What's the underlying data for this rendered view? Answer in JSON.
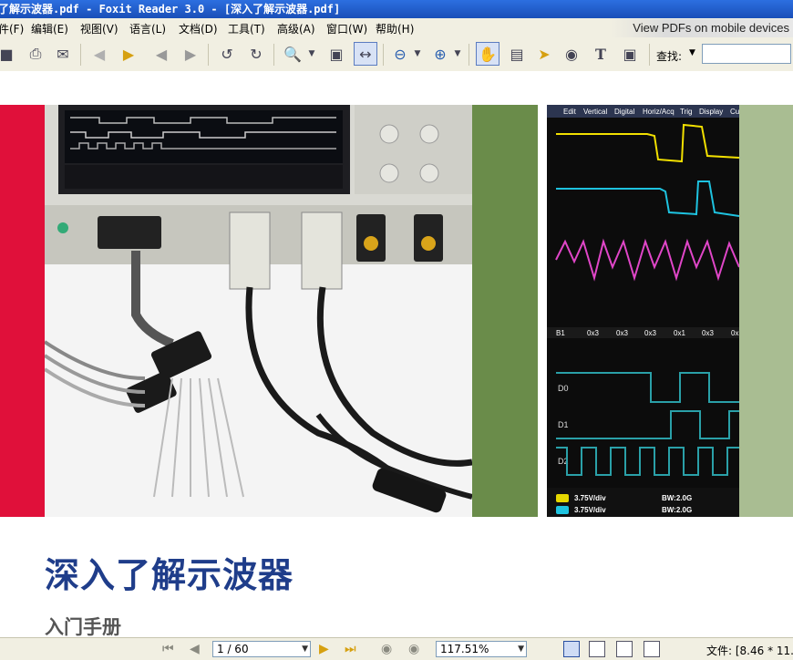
{
  "window": {
    "title": "了解示波器.pdf - Foxit Reader 3.0 - [深入了解示波器.pdf]"
  },
  "menu": [
    {
      "label": "件(F)"
    },
    {
      "label": "编辑(E)"
    },
    {
      "label": "视图(V)"
    },
    {
      "label": "语言(L)"
    },
    {
      "label": "文档(D)"
    },
    {
      "label": "工具(T)"
    },
    {
      "label": "高级(A)"
    },
    {
      "label": "窗口(W)"
    },
    {
      "label": "帮助(H)"
    }
  ],
  "promo": {
    "text": "View PDFs on mobile devices"
  },
  "toolbar": {
    "search_label": "查找:",
    "search_value": ""
  },
  "scope_labels": {
    "menu": [
      "Edit",
      "Vertical",
      "Digital",
      "Horiz/Acq",
      "Trig",
      "Display",
      "Cu"
    ],
    "bus": [
      "B1",
      "0x3",
      "0x3",
      "0x3",
      "0x1",
      "0x3",
      "0x"
    ],
    "channels": [
      "D0",
      "D1",
      "D2"
    ],
    "readouts": [
      "3.75V/div",
      "3.75V/div"
    ],
    "bw": [
      "BW:2.0G",
      "BW:2.0G"
    ]
  },
  "document": {
    "title": "深入了解示波器",
    "subtitle": "入门手册"
  },
  "status": {
    "page": "1 / 60",
    "zoom": "117.51%",
    "file_info": "文件: [8.46 * 11.0"
  },
  "colors": {
    "title_blue": "#1f3d8a",
    "red_band": "#e0103a",
    "green_band": "#6a8c4a"
  }
}
